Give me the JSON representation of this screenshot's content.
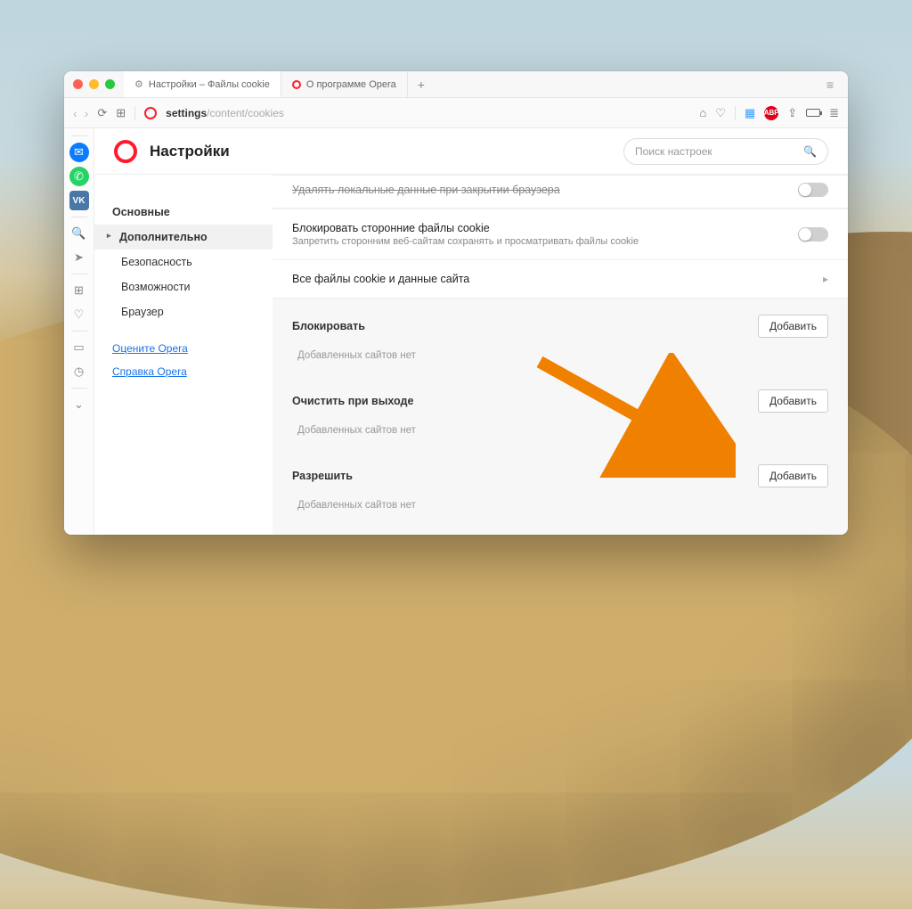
{
  "tabs": {
    "active": {
      "label": "Настройки – Файлы cookie",
      "icon": "gear-icon"
    },
    "second": {
      "label": "О программе Opera",
      "icon": "opera-icon"
    }
  },
  "url": {
    "bold": "settings",
    "rest": "/content/cookies"
  },
  "header": {
    "title": "Настройки",
    "search_placeholder": "Поиск настроек"
  },
  "sidebar": {
    "items": [
      "Основные",
      "Дополнительно",
      "Безопасность",
      "Возможности",
      "Браузер"
    ],
    "links": [
      "Оцените Opera",
      "Справка Opera"
    ]
  },
  "content": {
    "truncated_row": "Удалять локальные данные при закрытии браузера",
    "block_third": {
      "title": "Блокировать сторонние файлы cookie",
      "subtitle": "Запретить сторонним веб-сайтам сохранять и просматривать файлы cookie"
    },
    "all_cookies": "Все файлы cookie и данные сайта",
    "sections": [
      {
        "label": "Блокировать",
        "button": "Добавить",
        "empty": "Добавленных сайтов нет"
      },
      {
        "label": "Очистить при выходе",
        "button": "Добавить",
        "empty": "Добавленных сайтов нет"
      },
      {
        "label": "Разрешить",
        "button": "Добавить",
        "empty": "Добавленных сайтов нет"
      }
    ]
  },
  "toolbar_icons": {
    "abp": "ABP"
  }
}
